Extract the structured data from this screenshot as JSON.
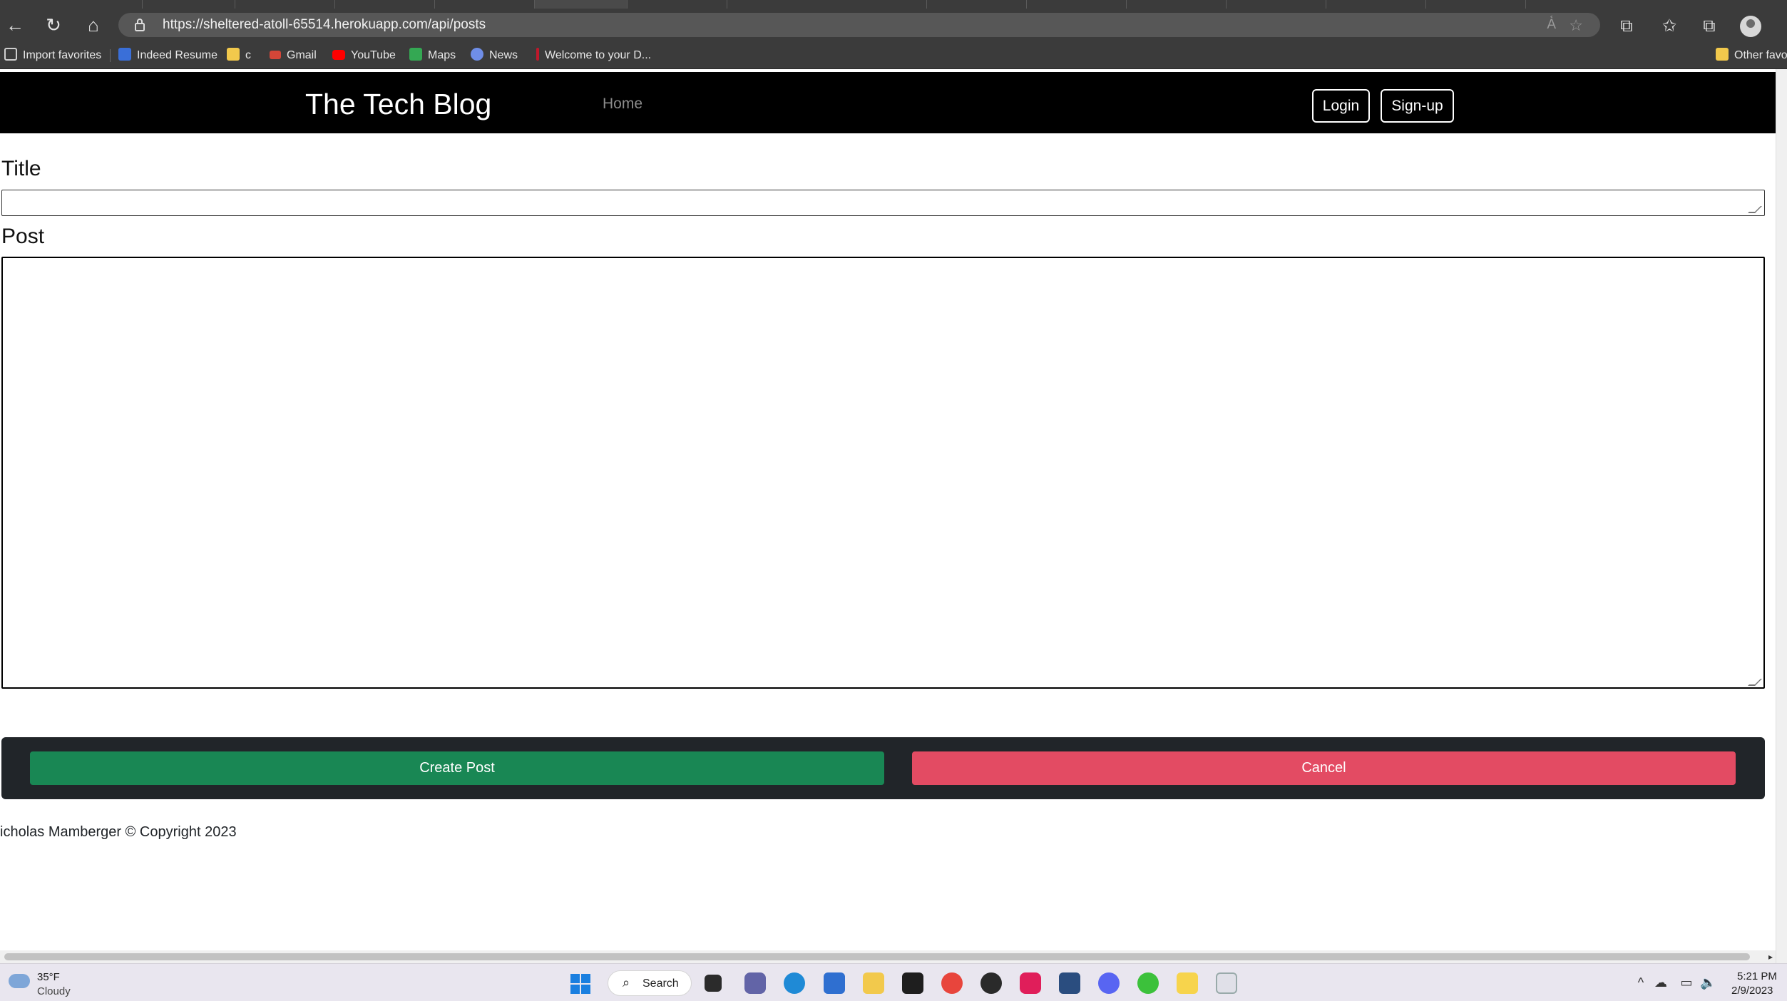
{
  "browser": {
    "url": "https://sheltered-atoll-65514.herokuapp.com/api/posts",
    "bookmarks": {
      "import": "Import favorites",
      "items": [
        "Indeed Resume",
        "c",
        "Gmail",
        "YouTube",
        "Maps",
        "News",
        "Welcome to your D..."
      ],
      "other": "Other favo"
    },
    "icons": {
      "back": "back-arrow-icon",
      "refresh": "refresh-icon",
      "home": "home-icon",
      "lock": "lock-icon",
      "read_aloud": "read-aloud-icon",
      "favorite": "add-favorite-icon",
      "extensions": "extensions-icon",
      "favorites": "favorites-icon",
      "collections": "collections-icon",
      "profile": "profile-icon"
    },
    "icon_glyphs": {
      "back": "←",
      "refresh": "↻",
      "home": "⌂",
      "lock": "🔒",
      "read_aloud": "A᷾",
      "favorite": "☆",
      "extensions": "⧉",
      "favorites": "✩",
      "collections": "⧉"
    }
  },
  "site": {
    "brand": "The Tech Blog",
    "nav": {
      "home": "Home",
      "login": "Login",
      "signup": "Sign-up"
    },
    "form": {
      "title_label": "Title",
      "post_label": "Post",
      "title_value": "",
      "post_value": ""
    },
    "actions": {
      "create": "Create Post",
      "cancel": "Cancel"
    },
    "footer": "icholas Mamberger © Copyright 2023"
  },
  "colors": {
    "navbar": "#000000",
    "create": "#198754",
    "cancel": "#e34b63",
    "actionbar": "#212529"
  },
  "taskbar": {
    "weather_temp": "35°F",
    "weather_desc": "Cloudy",
    "search": "Search",
    "time": "5:21 PM",
    "date": "2/9/2023"
  }
}
